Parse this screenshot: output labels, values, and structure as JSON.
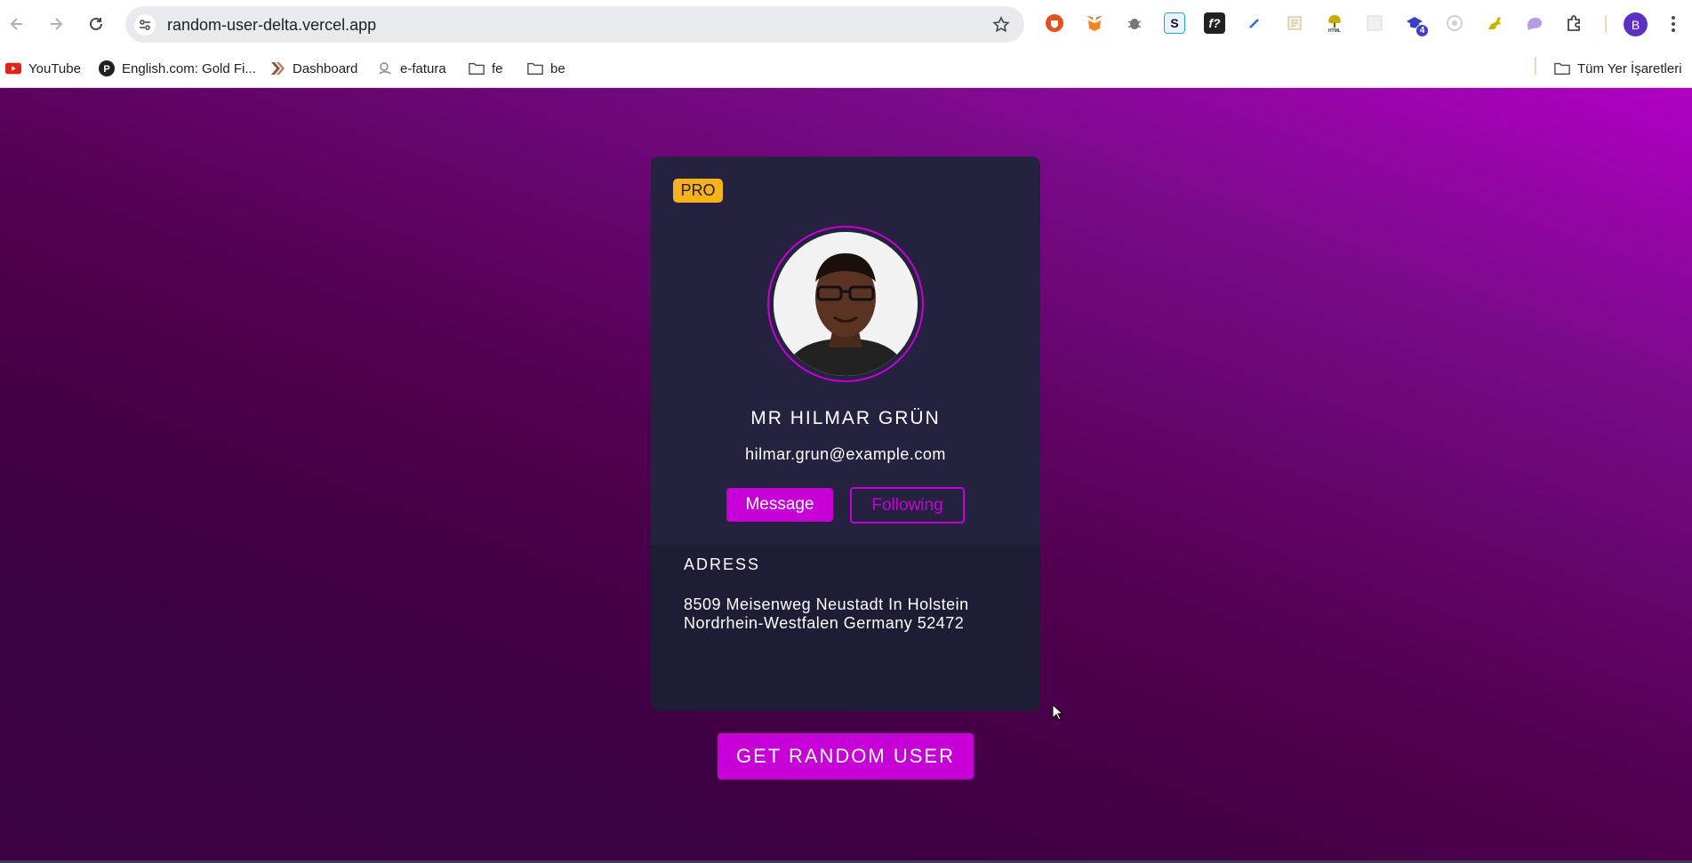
{
  "browser": {
    "url": "random-user-delta.vercel.app",
    "profile_initial": "B",
    "extension_badge": "4",
    "bookmarks": [
      {
        "label": "YouTube",
        "icon": "youtube-icon"
      },
      {
        "label": "English.com: Gold Fi...",
        "icon": "pearson-icon"
      },
      {
        "label": "Dashboard",
        "icon": "dashboard-icon"
      },
      {
        "label": "e-fatura",
        "icon": "efatura-icon"
      },
      {
        "label": "fe",
        "icon": "folder-icon"
      },
      {
        "label": "be",
        "icon": "folder-icon"
      }
    ],
    "all_bookmarks_label": "Tüm Yer İşaretleri"
  },
  "card": {
    "badge": "PRO",
    "name": "MR HILMAR GRÜN",
    "email": "hilmar.grun@example.com",
    "message_label": "Message",
    "following_label": "Following",
    "address_title": "ADRESS",
    "address_line1": "8509 Meisenweg Neustadt In Holstein",
    "address_line2": "Nordrhein-Westfalen Germany 52472"
  },
  "actions": {
    "get_random_user_label": "GET RANDOM USER"
  },
  "colors": {
    "accent": "#c600d6",
    "card_bg": "#1e1d36",
    "pro_badge": "#f6b21a"
  }
}
